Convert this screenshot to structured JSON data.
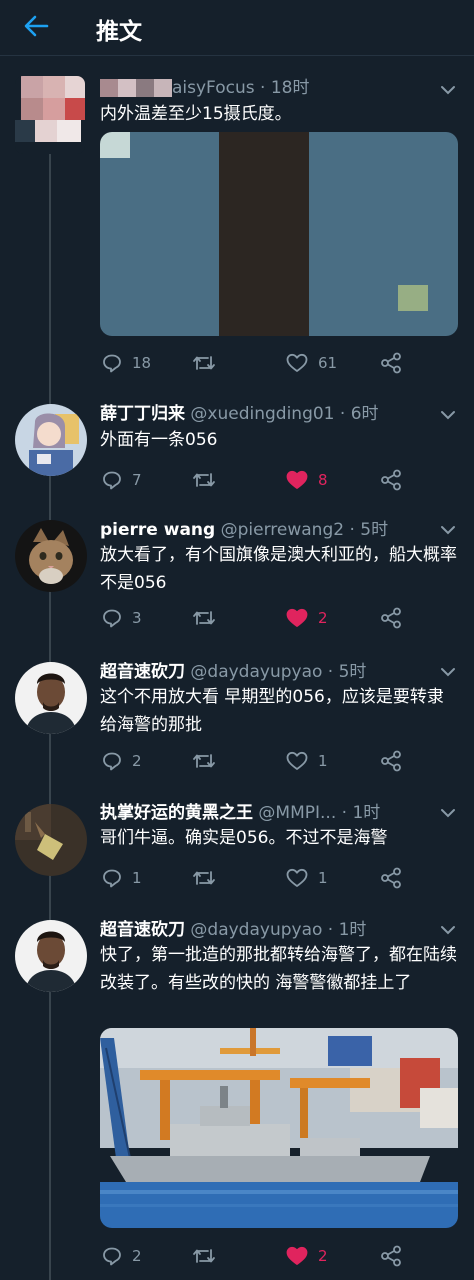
{
  "header": {
    "title": "推文"
  },
  "tweets": [
    {
      "name": "",
      "handle": "aisyFocus",
      "time": "18时",
      "text": "内外温差至少15摄氏度。",
      "replies": "18",
      "retweets": "",
      "likes": "61",
      "liked": false
    },
    {
      "name": "薛丁丁归来",
      "handle": "@xuedingding01",
      "time": "6时",
      "text": "外面有一条056",
      "replies": "7",
      "retweets": "",
      "likes": "8",
      "liked": true
    },
    {
      "name": "pierre wang",
      "handle": "@pierrewang2",
      "time": "5时",
      "text": "放大看了，有个国旗像是澳大利亚的，船大概率不是056",
      "replies": "3",
      "retweets": "",
      "likes": "2",
      "liked": true
    },
    {
      "name": "超音速砍刀",
      "handle": "@daydayupyao",
      "time": "5时",
      "text": "这个不用放大看 早期型的056，应该是要转隶给海警的那批",
      "replies": "2",
      "retweets": "",
      "likes": "1",
      "liked": false
    },
    {
      "name": "执掌好运的黄黑之王",
      "handle": "@MMPI...",
      "time": "1时",
      "text": "哥们牛逼。确实是056。不过不是海警",
      "replies": "1",
      "retweets": "",
      "likes": "1",
      "liked": false
    },
    {
      "name": "超音速砍刀",
      "handle": "@daydayupyao",
      "time": "1时",
      "text": "快了，第一批造的那批都转给海警了，都在陆续改装了。有些改的快的 海警警徽都挂上了",
      "replies": "2",
      "retweets": "",
      "likes": "2",
      "liked": true
    }
  ],
  "colors": {
    "background": "#15202b",
    "accent": "#1da1f2",
    "muted": "#8899a6",
    "like": "#e0245e",
    "divider": "#38444d"
  },
  "icons": {
    "back": "arrow-left-icon",
    "caret": "chevron-down-icon",
    "reply": "reply-icon",
    "retweet": "retweet-icon",
    "like": "heart-icon",
    "share": "share-icon"
  }
}
